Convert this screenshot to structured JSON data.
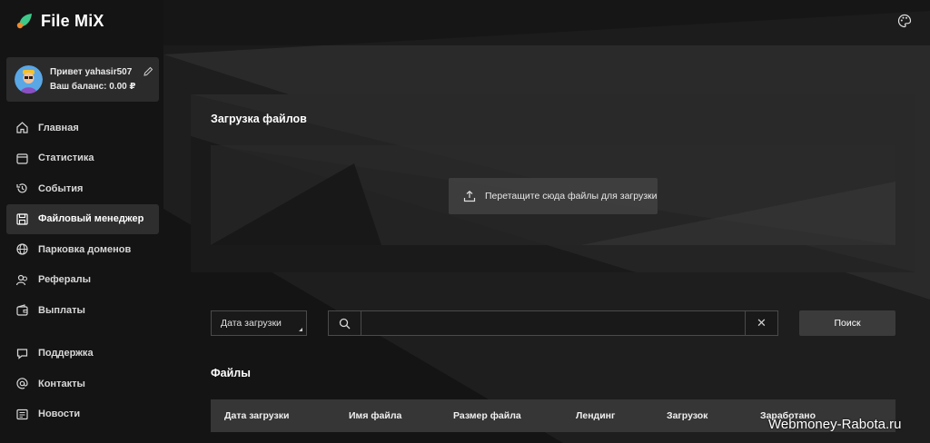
{
  "app": {
    "name": "File MiX"
  },
  "user": {
    "greeting": "Привет yahasir507",
    "balance": "Ваш баланс: 0.00 ₽"
  },
  "sidebar": {
    "items": [
      {
        "label": "Главная",
        "icon": "home-icon"
      },
      {
        "label": "Статистика",
        "icon": "calendar-icon"
      },
      {
        "label": "События",
        "icon": "history-icon"
      },
      {
        "label": "Файловый менеджер",
        "icon": "save-icon",
        "active": true
      },
      {
        "label": "Парковка доменов",
        "icon": "globe-icon"
      },
      {
        "label": "Рефералы",
        "icon": "users-icon"
      },
      {
        "label": "Выплаты",
        "icon": "wallet-icon"
      },
      {
        "label": "Поддержка",
        "icon": "chat-icon"
      },
      {
        "label": "Контакты",
        "icon": "at-icon"
      },
      {
        "label": "Новости",
        "icon": "news-icon"
      }
    ]
  },
  "upload": {
    "title": "Загрузка файлов",
    "dropzone_label": "Перетащите сюда файлы для загрузки"
  },
  "filters": {
    "date_select": "Дата загрузки",
    "search_value": "",
    "clear": "✕",
    "search_button": "Поиск"
  },
  "files": {
    "title": "Файлы",
    "columns": [
      "Дата загрузки",
      "Имя файла",
      "Размер файла",
      "Лендинг",
      "Загрузок",
      "Заработано"
    ]
  },
  "watermark": "Webmoney-Rabota.ru",
  "colors": {
    "background": "#141414",
    "panel": "#2b2b2b",
    "accent_green": "#3ec98a",
    "accent_orange": "#f08a2c"
  }
}
